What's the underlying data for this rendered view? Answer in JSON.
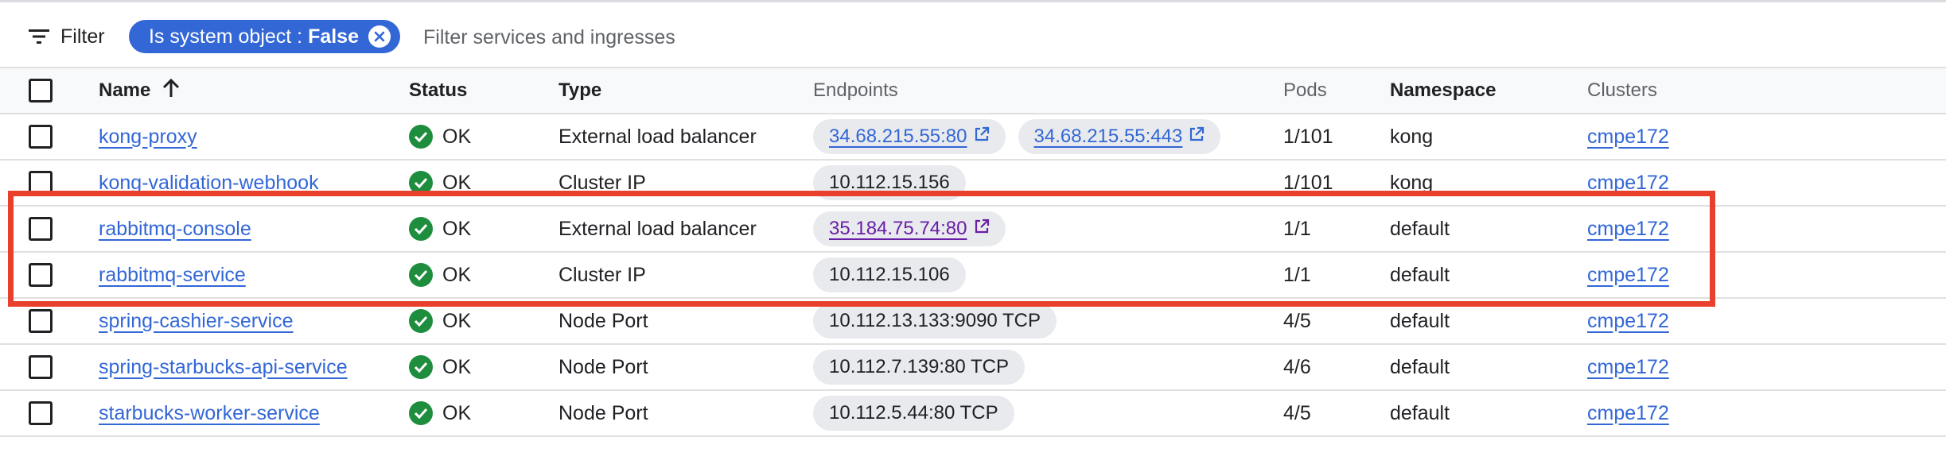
{
  "filter": {
    "label": "Filter",
    "chip_key": "Is system object : ",
    "chip_value": "False",
    "placeholder": "Filter services and ingresses"
  },
  "columns": {
    "name": "Name",
    "status": "Status",
    "type": "Type",
    "endpoints": "Endpoints",
    "pods": "Pods",
    "namespace": "Namespace",
    "clusters": "Clusters"
  },
  "rows": [
    {
      "name": "kong-proxy",
      "status": "OK",
      "type": "External load balancer",
      "endpoints": [
        "34.68.215.55:80",
        "34.68.215.55:443"
      ],
      "pods": "1/101",
      "namespace": "kong",
      "cluster": "cmpe172"
    },
    {
      "name": "kong-validation-webhook",
      "status": "OK",
      "type": "Cluster IP",
      "endpoints": [
        "10.112.15.156"
      ],
      "pods": "1/101",
      "namespace": "kong",
      "cluster": "cmpe172"
    },
    {
      "name": "rabbitmq-console",
      "status": "OK",
      "type": "External load balancer",
      "endpoints": [
        "35.184.75.74:80"
      ],
      "pods": "1/1",
      "namespace": "default",
      "cluster": "cmpe172"
    },
    {
      "name": "rabbitmq-service",
      "status": "OK",
      "type": "Cluster IP",
      "endpoints": [
        "10.112.15.106"
      ],
      "pods": "1/1",
      "namespace": "default",
      "cluster": "cmpe172"
    },
    {
      "name": "spring-cashier-service",
      "status": "OK",
      "type": "Node Port",
      "endpoints": [
        "10.112.13.133:9090 TCP"
      ],
      "pods": "4/5",
      "namespace": "default",
      "cluster": "cmpe172"
    },
    {
      "name": "spring-starbucks-api-service",
      "status": "OK",
      "type": "Node Port",
      "endpoints": [
        "10.112.7.139:80 TCP"
      ],
      "pods": "4/6",
      "namespace": "default",
      "cluster": "cmpe172"
    },
    {
      "name": "starbucks-worker-service",
      "status": "OK",
      "type": "Node Port",
      "endpoints": [
        "10.112.5.44:80 TCP"
      ],
      "pods": "4/5",
      "namespace": "default",
      "cluster": "cmpe172"
    }
  ],
  "colors": {
    "accent": "#3367d6",
    "ok": "#1e8e3e",
    "visited": "#681da8",
    "highlight": "#e8402c"
  }
}
